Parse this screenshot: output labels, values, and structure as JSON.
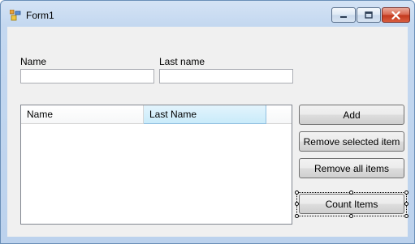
{
  "window": {
    "title": "Form1"
  },
  "form": {
    "name_label": "Name",
    "name_value": "",
    "lastname_label": "Last name",
    "lastname_value": ""
  },
  "list": {
    "columns": [
      {
        "label": "Name",
        "selected": false
      },
      {
        "label": "Last Name",
        "selected": true
      }
    ],
    "rows": []
  },
  "buttons": {
    "add": "Add",
    "remove_selected": "Remove selected item",
    "remove_all": "Remove all items",
    "count": "Count Items"
  },
  "colors": {
    "title_bar": "#c4d8f0",
    "client_bg": "#f0f0f0",
    "close_button": "#c2381d",
    "selected_column": "#c9ebfa"
  }
}
